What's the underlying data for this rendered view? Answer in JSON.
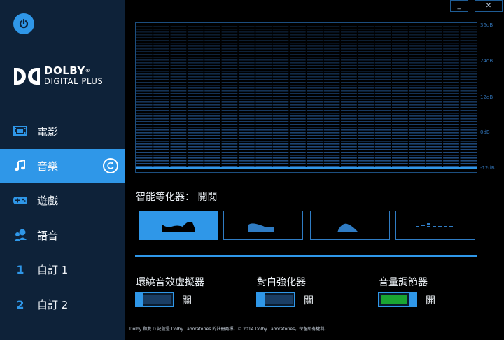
{
  "window": {
    "minimize_label": "_",
    "close_label": "✕"
  },
  "logo": {
    "line1": "DOLBY",
    "line1_mark": "®",
    "line2": "DIGITAL PLUS"
  },
  "nav": {
    "items": [
      {
        "label": "電影",
        "icon": "film-icon"
      },
      {
        "label": "音樂",
        "icon": "music-note-icon"
      },
      {
        "label": "遊戲",
        "icon": "gamepad-icon"
      },
      {
        "label": "語音",
        "icon": "voice-chat-icon"
      },
      {
        "label": "自訂 1",
        "icon": "custom-1-icon",
        "glyph": "1"
      },
      {
        "label": "自訂 2",
        "icon": "custom-2-icon",
        "glyph": "2"
      }
    ],
    "active_index": 1
  },
  "equalizer": {
    "db_labels": [
      "36dB",
      "24dB",
      "12dB",
      "0dB",
      "-12dB"
    ],
    "intelligent_eq_label": "智能等化器：",
    "intelligent_eq_state": "開閱",
    "presets": [
      "open-preset-icon",
      "rich-preset-icon",
      "focused-preset-icon",
      "manual-preset-icon"
    ],
    "active_preset": 0
  },
  "toggles": [
    {
      "label": "環繞音效虛擬器",
      "state": "關",
      "on": false
    },
    {
      "label": "對白強化器",
      "state": "關",
      "on": false
    },
    {
      "label": "音量調節器",
      "state": "開",
      "on": true
    }
  ],
  "footer": "Dolby 和雙 D 記號是 Dolby Laboratories 的註冊商標。© 2014 Dolby Laboratories。保留所有權利。",
  "colors": {
    "accent": "#2f97e8",
    "sidebar": "#0e2239",
    "on": "#1aa532"
  }
}
